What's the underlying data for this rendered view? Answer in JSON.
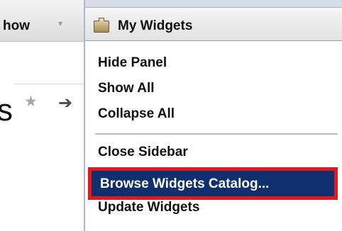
{
  "toolbar": {
    "show_label": "how",
    "show_dropdown_arrow": "▾"
  },
  "nav": {
    "partial_letter": "s",
    "star_icon": "★",
    "arrow_icon": "➔"
  },
  "panel": {
    "title": "My Widgets",
    "menu": {
      "hide_panel": "Hide Panel",
      "show_all": "Show All",
      "collapse_all": "Collapse All",
      "close_sidebar": "Close Sidebar",
      "browse_catalog": "Browse Widgets Catalog...",
      "update_widgets": "Update Widgets"
    }
  },
  "colors": {
    "highlight_background": "#0f2f6f",
    "highlight_border": "#e01a1a"
  }
}
